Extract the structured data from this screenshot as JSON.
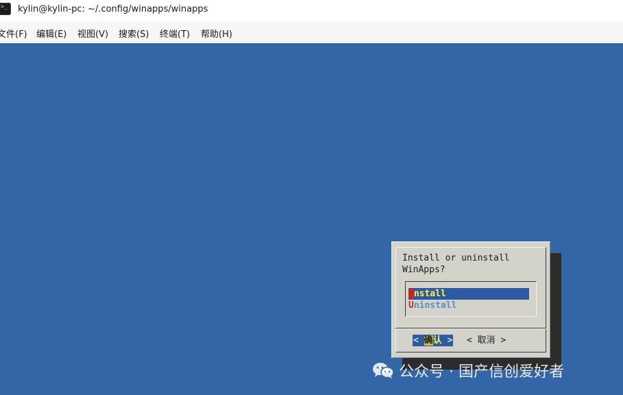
{
  "window": {
    "title": "kylin@kylin-pc: ~/.config/winapps/winapps",
    "icon": "terminal-icon",
    "icon_prompt": ">_"
  },
  "menubar": {
    "items": [
      {
        "label": "文件(F)"
      },
      {
        "label": "编辑(E)"
      },
      {
        "label": "视图(V)"
      },
      {
        "label": "搜索(S)"
      },
      {
        "label": "终端(T)"
      },
      {
        "label": "帮助(H)"
      }
    ]
  },
  "terminal": {
    "background": "#3465a4"
  },
  "dialog": {
    "prompt": "Install or uninstall WinApps?",
    "options": [
      {
        "hotkey": "I",
        "rest": "nstall",
        "selected": true
      },
      {
        "hotkey": "U",
        "rest": "ninstall",
        "selected": false
      }
    ],
    "buttons": {
      "confirm": {
        "left": "<",
        "first": "确",
        "rest": "认",
        "right": ">"
      },
      "cancel": {
        "left": "<",
        "label": "取消",
        "right": ">"
      }
    },
    "colors": {
      "dialog_bg": "#d3d3cc",
      "selection_bg": "#2e5aa2",
      "selection_fg": "#fff34d",
      "hotkey": "#c0262c"
    }
  },
  "watermark": {
    "icon": "wechat-icon",
    "text": "公众号 · 国产信创爱好者"
  }
}
